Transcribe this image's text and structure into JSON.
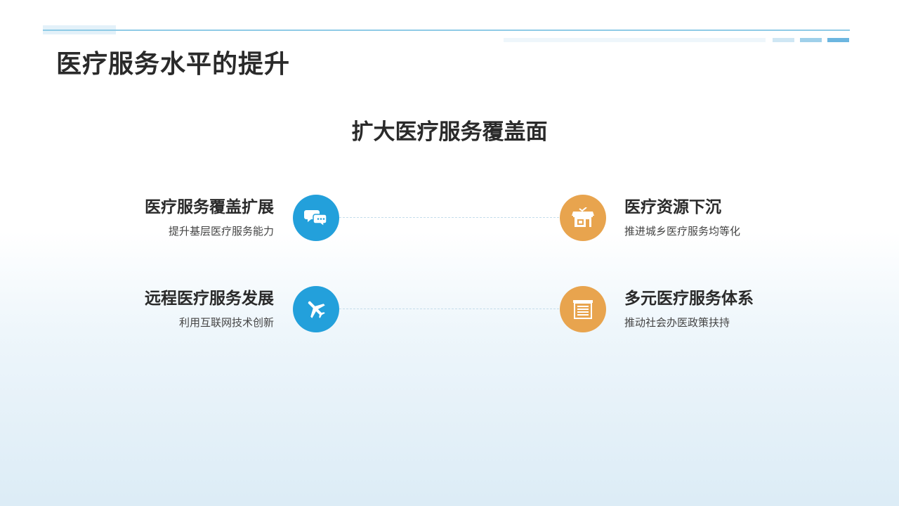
{
  "header": {
    "title": "医疗服务水平的提升"
  },
  "section": {
    "title": "扩大医疗服务覆盖面"
  },
  "items": [
    {
      "title": "医疗服务覆盖扩展",
      "desc": "提升基层医疗服务能力",
      "icon": "chat-bubbles-icon",
      "color": "#23a0db"
    },
    {
      "title": "医疗资源下沉",
      "desc": "推进城乡医疗服务均等化",
      "icon": "shop-icon",
      "color": "#e8a44e"
    },
    {
      "title": "远程医疗服务发展",
      "desc": "利用互联网技术创新",
      "icon": "airplane-icon",
      "color": "#23a0db"
    },
    {
      "title": "多元医疗服务体系",
      "desc": "推动社会办医政策扶持",
      "icon": "shutter-icon",
      "color": "#e8a44e"
    }
  ]
}
